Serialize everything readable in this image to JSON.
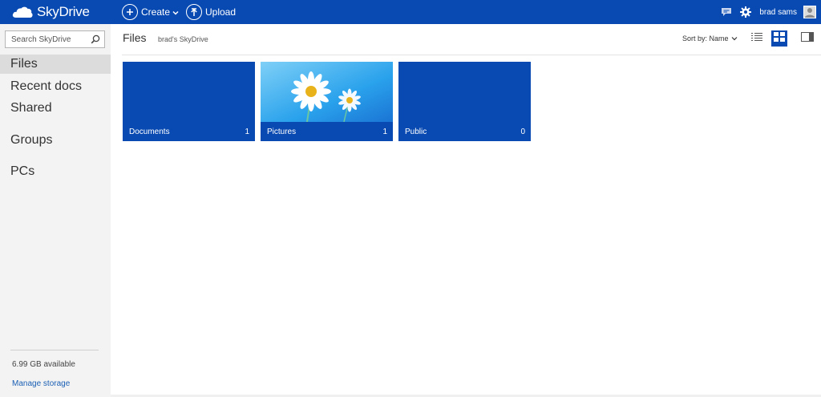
{
  "app": {
    "brand": "SkyDrive",
    "brand_color": "#094ab2"
  },
  "toolbar": {
    "create_label": "Create",
    "upload_label": "Upload"
  },
  "user": {
    "name": "brad sams"
  },
  "search": {
    "placeholder": "Search SkyDrive"
  },
  "sidebar": {
    "items": [
      {
        "label": "Files",
        "active": true
      },
      {
        "label": "Recent docs"
      },
      {
        "label": "Shared"
      },
      {
        "label": "Groups"
      },
      {
        "label": "PCs"
      }
    ],
    "storage_text": "6.99 GB available",
    "manage_label": "Manage storage"
  },
  "main": {
    "title": "Files",
    "breadcrumb": "brad's SkyDrive",
    "sort_label": "Sort by: Name"
  },
  "folders": [
    {
      "name": "Documents",
      "count": "1"
    },
    {
      "name": "Pictures",
      "count": "1"
    },
    {
      "name": "Public",
      "count": "0"
    }
  ],
  "icons": {
    "brand": "cloud-icon",
    "create": "plus-circle-icon",
    "upload": "upload-circle-icon",
    "feedback": "feedback-icon",
    "settings": "gear-icon",
    "search": "search-icon",
    "list_view": "list-view-icon",
    "tile_view": "tile-view-icon",
    "details_pane": "details-pane-icon"
  }
}
